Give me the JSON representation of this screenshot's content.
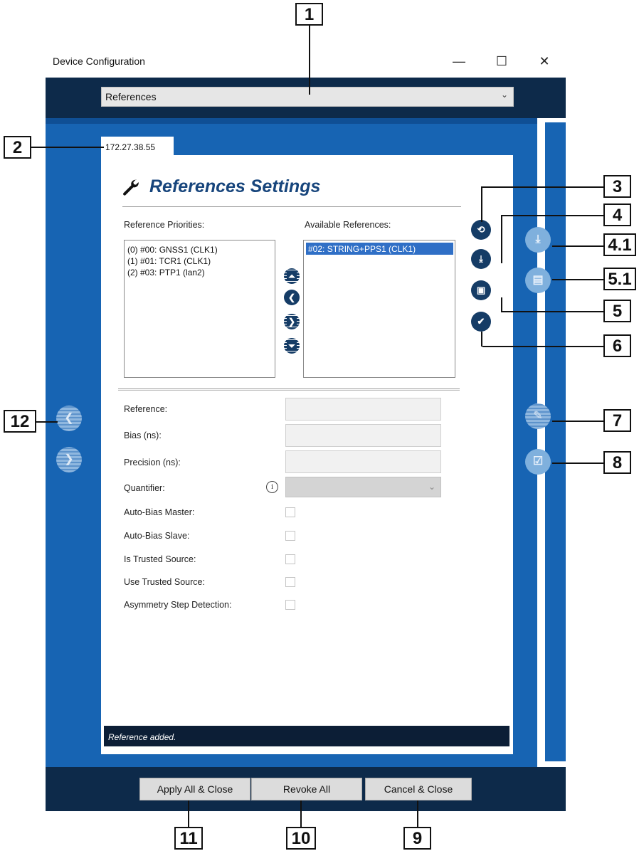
{
  "window": {
    "title": "Device Configuration",
    "minimize": "—",
    "maximize": "☐",
    "close": "✕"
  },
  "dropdown": {
    "value": "References",
    "arrow": "⌄"
  },
  "tab": {
    "label": "172.27.38.55"
  },
  "panel": {
    "heading": "References Settings",
    "priorities_label": "Reference Priorities:",
    "available_label": "Available References:",
    "priorities": [
      "(0) #00: GNSS1 (CLK1)",
      "(1) #01: TCR1 (CLK1)",
      "(2) #03: PTP1 (lan2)"
    ],
    "available": [
      "#02: STRING+PPS1 (CLK1)"
    ]
  },
  "form": {
    "reference": "Reference:",
    "bias": "Bias (ns):",
    "precision": "Precision (ns):",
    "quantifier": "Quantifier:",
    "auto_bias_master": "Auto-Bias Master:",
    "auto_bias_slave": "Auto-Bias Slave:",
    "is_trusted": "Is Trusted Source:",
    "use_trusted": "Use Trusted Source:",
    "asymmetry": "Asymmetry Step Detection:",
    "info": "i"
  },
  "status": {
    "message": "Reference added."
  },
  "buttons": {
    "apply_all": "Apply All & Close",
    "revoke_all": "Revoke All",
    "cancel": "Cancel & Close"
  },
  "callouts": {
    "c1": "1",
    "c2": "2",
    "c3": "3",
    "c4": "4",
    "c41": "4.1",
    "c5": "5",
    "c51": "5.1",
    "c6": "6",
    "c7": "7",
    "c8": "8",
    "c9": "9",
    "c10": "10",
    "c11": "11",
    "c12": "12"
  },
  "colors": {
    "accent": "#1764b3",
    "dark_bar": "#0d2a4a",
    "heading": "#17457c",
    "selection": "#2f6fc6"
  }
}
